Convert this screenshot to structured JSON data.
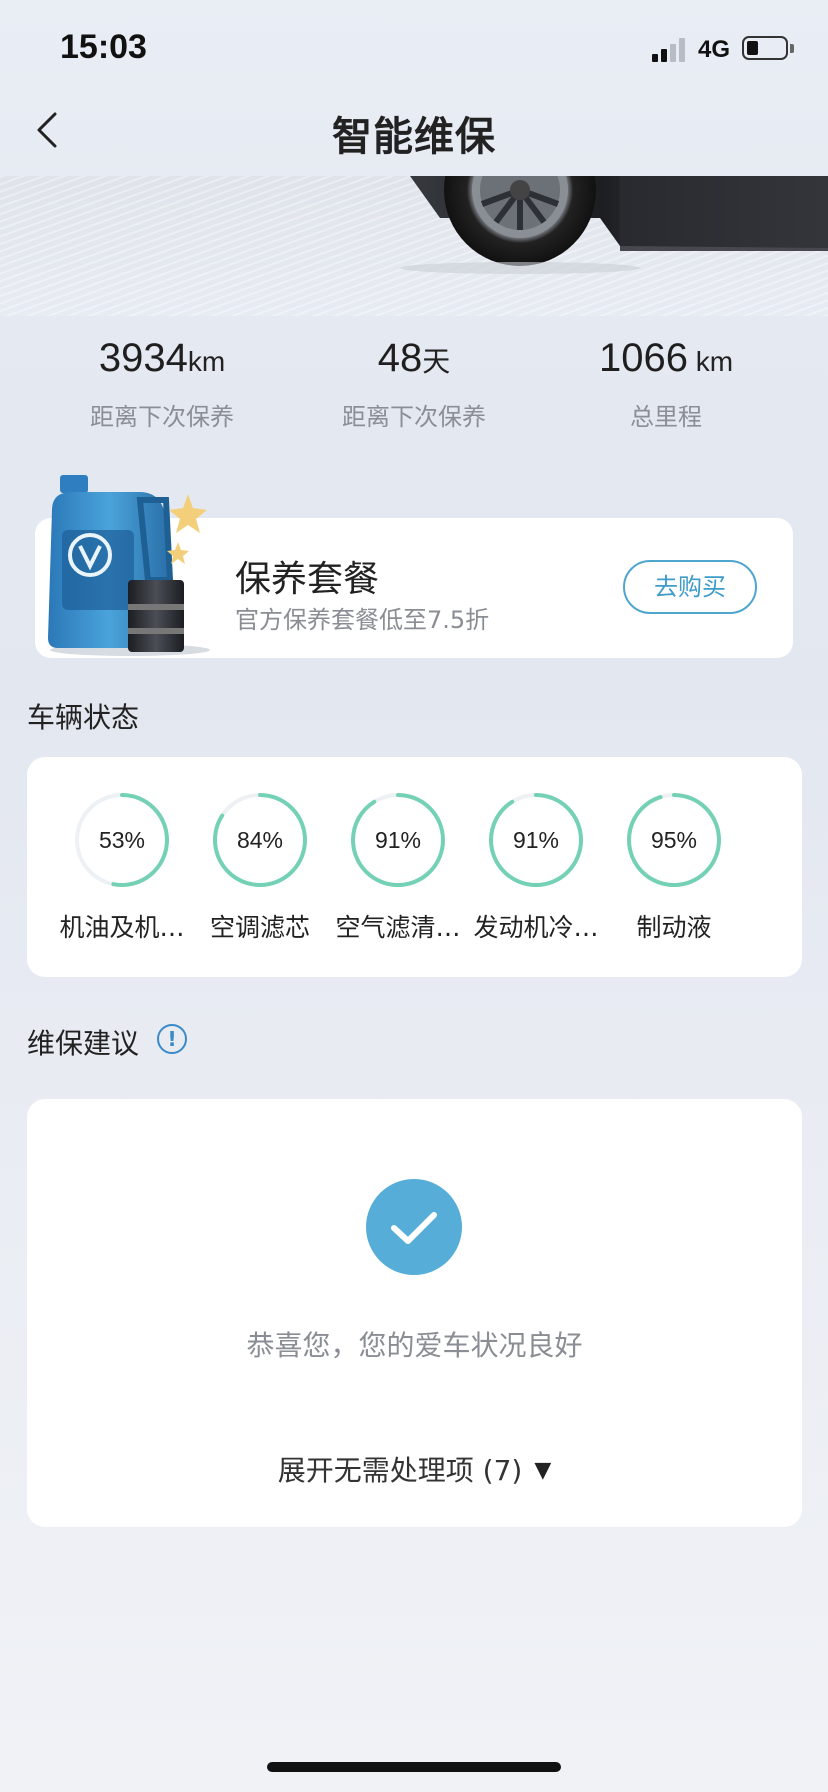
{
  "status_bar": {
    "time": "15:03",
    "network": "4G"
  },
  "header": {
    "title": "智能维保"
  },
  "stats": [
    {
      "value": "3934",
      "unit": "km",
      "label": "距离下次保养"
    },
    {
      "value": "48",
      "unit": "天",
      "label": "距离下次保养"
    },
    {
      "value": "1066",
      "unit": " km",
      "label": "总里程"
    }
  ],
  "package": {
    "title": "保养套餐",
    "subtitle": "官方保养套餐低至7.5折",
    "buy_label": "去购买"
  },
  "vehicle_status": {
    "section_title": "车辆状态",
    "items": [
      {
        "percent": 53,
        "percent_label": "53%",
        "label": "机油及机…"
      },
      {
        "percent": 84,
        "percent_label": "84%",
        "label": "空调滤芯"
      },
      {
        "percent": 91,
        "percent_label": "91%",
        "label": "空气滤清…"
      },
      {
        "percent": 91,
        "percent_label": "91%",
        "label": "发动机冷…"
      },
      {
        "percent": 95,
        "percent_label": "95%",
        "label": "制动液"
      }
    ]
  },
  "advice": {
    "section_title": "维保建议",
    "info_symbol": "!",
    "message": "恭喜您，您的爱车状况良好",
    "expand_label": "展开无需处理项 (7)",
    "expand_arrow": "▼"
  },
  "colors": {
    "accent": "#56add8",
    "gauge": "#74d1b5",
    "gauge_track": "#eef1f4",
    "buy_border": "#4ea6cf"
  }
}
